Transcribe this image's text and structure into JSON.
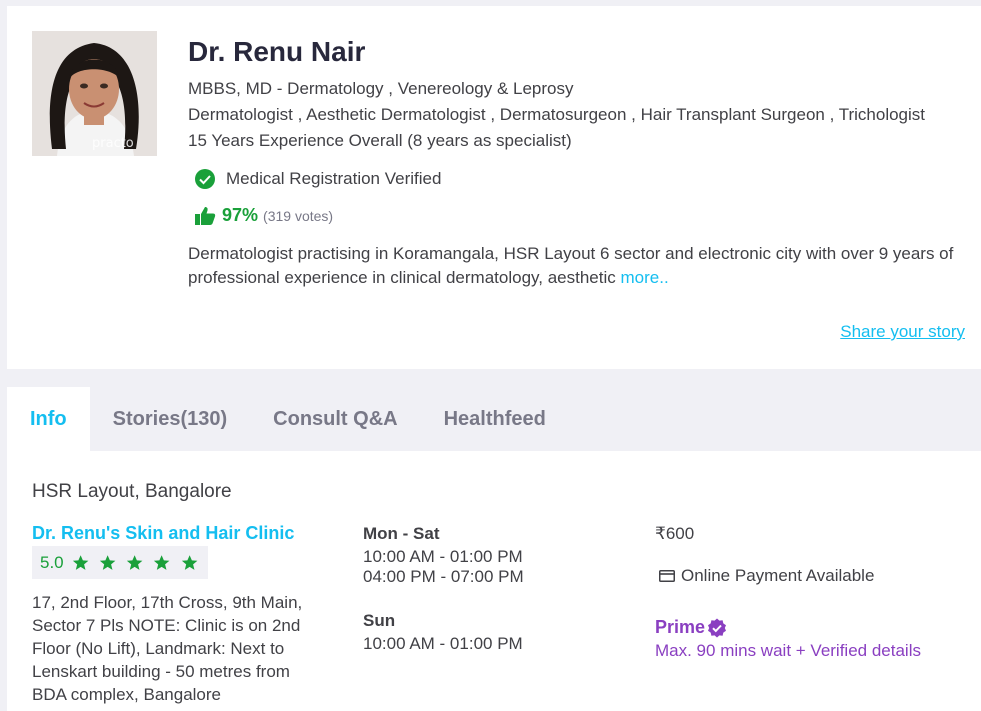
{
  "doctor": {
    "name": "Dr. Renu Nair",
    "qualifications": "MBBS, MD - Dermatology , Venereology & Leprosy",
    "specialities": "Dermatologist , Aesthetic Dermatologist , Dermatosurgeon , Hair Transplant Surgeon , Trichologist",
    "experience": "15 Years Experience Overall  (8 years as specialist)",
    "registration": "Medical Registration Verified",
    "rating_pct": "97%",
    "votes": "(319 votes)",
    "about": "Dermatologist practising in Koramangala, HSR Layout 6 sector and electronic city with over 9 years of professional experience in clinical dermatology, aesthetic ",
    "more_link": "more..",
    "share_story": "Share your story",
    "photo_watermark": "practo"
  },
  "tabs": [
    {
      "label": "Info",
      "active": true
    },
    {
      "label": "Stories(130)",
      "active": false
    },
    {
      "label": "Consult Q&A",
      "active": false
    },
    {
      "label": "Healthfeed",
      "active": false
    }
  ],
  "clinic": {
    "locality": "HSR Layout, Bangalore",
    "name": "Dr. Renu's Skin and Hair Clinic",
    "rating": "5.0",
    "stars": 5,
    "address": "17, 2nd Floor, 17th Cross, 9th Main, Sector 7 Pls NOTE: Clinic is on 2nd Floor (No Lift), Landmark: Next to Lenskart building - 50 metres from BDA complex, Bangalore",
    "schedule": [
      {
        "days": "Mon - Sat",
        "slots": [
          "10:00 AM - 01:00 PM",
          "04:00 PM - 07:00 PM"
        ]
      },
      {
        "days": "Sun",
        "slots": [
          "10:00 AM - 01:00 PM"
        ]
      }
    ],
    "fee": "₹600",
    "payment": "Online Payment Available",
    "prime_label": "Prime",
    "prime_detail": "Max. 90 mins wait + Verified details"
  },
  "colors": {
    "accent": "#14bef0",
    "green": "#1aa03a",
    "prime": "#8a3fc1",
    "background": "#f0f0f5"
  },
  "icons": [
    "check-circle-icon",
    "thumbs-up-icon",
    "star-icon",
    "credit-card-icon",
    "verified-badge-icon"
  ]
}
